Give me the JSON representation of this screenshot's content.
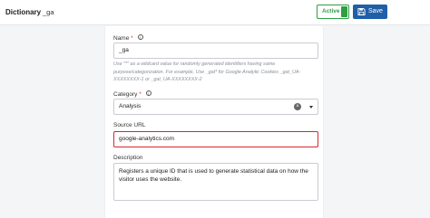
{
  "header": {
    "title": "Dictionary",
    "subtitle": "_ga",
    "active_label": "Active",
    "save_label": "Save"
  },
  "form": {
    "name": {
      "label": "Name",
      "required_mark": "*",
      "value": "_ga",
      "hint": "Use \"*\" as a wildcard value for randomly generated identifiers having same purpose/categorization. For example, Use _gat* for Google Analytic Cookies _gat_UA-XXXXXXXX-1 or _gat_UA-XXXXXXXX-2"
    },
    "category": {
      "label": "Category",
      "required_mark": "*",
      "value": "Analysis"
    },
    "source_url": {
      "label": "Source URL",
      "value": "google-analytics.com"
    },
    "description": {
      "label": "Description",
      "value": "Registers a unique ID that is used to generate statistical data on how the visitor uses the website."
    }
  },
  "colors": {
    "active_green": "#2f9e44",
    "save_blue": "#1f5fa8",
    "focus_red": "#d8262f"
  }
}
